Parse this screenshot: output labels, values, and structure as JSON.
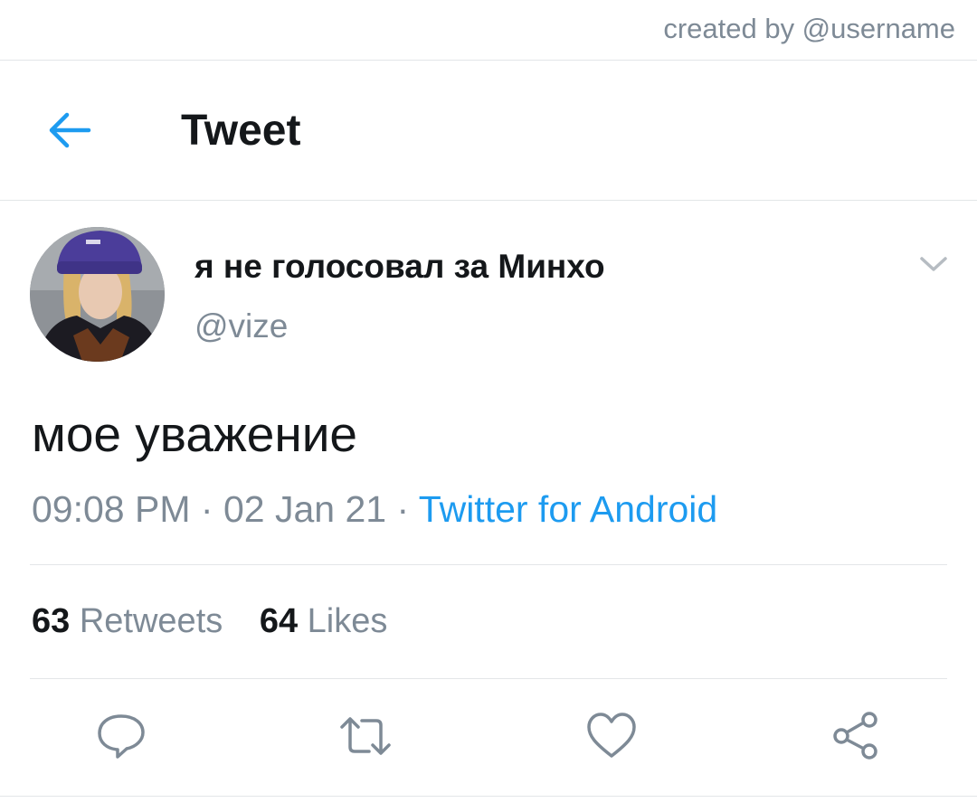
{
  "credit": "created by @username",
  "header": {
    "title": "Tweet",
    "back_icon": "arrow-left-icon",
    "accent_color": "#1d9bf0"
  },
  "tweet": {
    "display_name": "я не голосовал за Минхо",
    "handle": "@vize",
    "text": "мое уважение",
    "time": "09:08 PM",
    "separator": "·",
    "date": "02 Jan 21",
    "source": "Twitter for Android",
    "retweets_count": "63",
    "retweets_label": "Retweets",
    "likes_count": "64",
    "likes_label": "Likes"
  },
  "actions": [
    {
      "name": "reply",
      "icon": "comment-bubble-icon"
    },
    {
      "name": "retweet",
      "icon": "retweet-icon"
    },
    {
      "name": "like",
      "icon": "heart-icon"
    },
    {
      "name": "share",
      "icon": "share-icon"
    }
  ],
  "colors": {
    "text_primary": "#14171a",
    "text_secondary": "#7e8a96",
    "link": "#1d9bf0",
    "divider": "#e3e6e8"
  }
}
